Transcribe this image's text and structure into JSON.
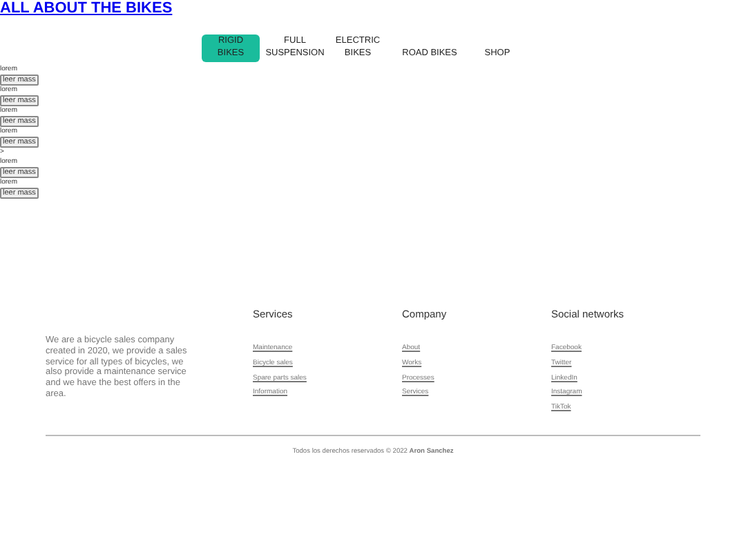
{
  "header": {
    "title": "ALL ABOUT THE BIKES"
  },
  "nav": [
    {
      "label": "RIGID BIKES",
      "selected": true
    },
    {
      "label": "FULL SUSPENSION",
      "selected": false
    },
    {
      "label": "ELECTRIC BIKES",
      "selected": false
    },
    {
      "label": "ROAD BIKES",
      "selected": false
    },
    {
      "label": "SHOP",
      "selected": false
    }
  ],
  "items": [
    {
      "kind": "card",
      "label": "lorem",
      "button": "leer mass"
    },
    {
      "kind": "card",
      "label": "lorem",
      "button": "leer mass"
    },
    {
      "kind": "card",
      "label": "lorem",
      "button": "leer mass"
    },
    {
      "kind": "card",
      "label": "lorem",
      "button": "leer mass"
    },
    {
      "kind": "marker",
      "label": ">"
    },
    {
      "kind": "card",
      "label": "lorem",
      "button": "leer mass"
    },
    {
      "kind": "card",
      "label": "lorem",
      "button": "leer mass"
    }
  ],
  "footer": {
    "about": "We are a bicycle sales company created in 2020, we provide a sales service for all types of bicycles, we also provide a maintenance service and we have the best offers in the area.",
    "columns": [
      {
        "heading": "Services",
        "links": [
          "Maintenance",
          "Bicycle sales",
          "Spare parts sales",
          "Information"
        ]
      },
      {
        "heading": "Company",
        "links": [
          "About",
          "Works",
          "Processes",
          "Services"
        ]
      },
      {
        "heading": "Social networks",
        "links": [
          "Facebook",
          "Twitter",
          "LinkedIn",
          "Instagram",
          "TikTok"
        ]
      }
    ],
    "copyright": "Todos los derechos reservados © 2022 **Aron Sanchez**"
  }
}
